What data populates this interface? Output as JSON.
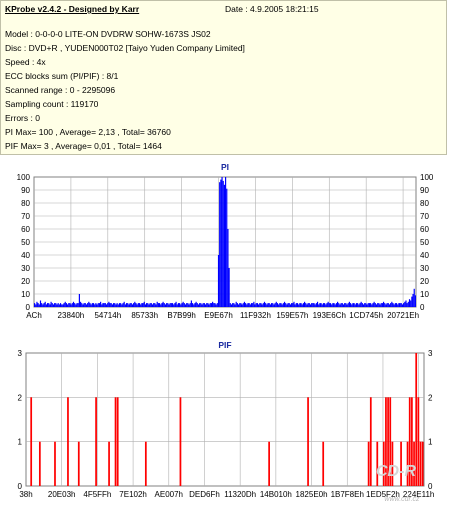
{
  "header": {
    "title": "KProbe v2.4.2 - Designed by Karr",
    "date": "Date : 4.9.2005 18:21:15"
  },
  "info_lines": [
    "Model : 0-0-0-0 LITE-ON DVDRW SOHW-1673S JS02",
    "Disc : DVD+R , YUDEN000T02 [Taiyo Yuden Company Limited]",
    "Speed : 4x",
    "ECC blocks sum (PI/PIF) : 8/1",
    "Scanned range : 0 - 2295096",
    "Sampling count : 119170",
    "Errors : 0",
    "PI Max= 100 , Average= 2,13 , Total= 36760",
    "PIF Max= 3 , Average= 0,01 , Total= 1464"
  ],
  "colors": {
    "info_bg": "#ffffe6",
    "pi_bar": "#0000ff",
    "pif_bar": "#ff0000",
    "title": "#1a2aa0",
    "grid": "#b0b0b0"
  },
  "watermark": "CD-R",
  "watermark_url": "www.cdr.cz",
  "chart_data": [
    {
      "type": "bar",
      "title": "PI",
      "xlabel": "",
      "ylabel": "",
      "ylim": [
        0,
        100
      ],
      "yticks": [
        0,
        10,
        20,
        30,
        40,
        50,
        60,
        70,
        80,
        90,
        100
      ],
      "grid": true,
      "x_tick_labels": [
        "ACh",
        "23840h",
        "54714h",
        "85733h",
        "B7B99h",
        "E9E67h",
        "11F932h",
        "159E57h",
        "193E6Ch",
        "1CD745h",
        "20721Eh"
      ],
      "series": [
        {
          "values": [
            3,
            2,
            4,
            3,
            2,
            5,
            3,
            2,
            3,
            4,
            2,
            3,
            3,
            2,
            4,
            3,
            2,
            3,
            3,
            2,
            3,
            2,
            3,
            2,
            2,
            3,
            4,
            3,
            2,
            3,
            3,
            2,
            3,
            4,
            3,
            2,
            3,
            3,
            10,
            4,
            3,
            2,
            3,
            3,
            2,
            3,
            4,
            3,
            2,
            3,
            3,
            2,
            3,
            2,
            3,
            3,
            4,
            2,
            3,
            3,
            3,
            2,
            3,
            4,
            3,
            3,
            2,
            3,
            3,
            2,
            3,
            2,
            3,
            3,
            2,
            3,
            4,
            2,
            3,
            3,
            2,
            3,
            3,
            2,
            3,
            4,
            3,
            2,
            3,
            3,
            2,
            3,
            3,
            4,
            2,
            3,
            3,
            2,
            3,
            3,
            2,
            3,
            3,
            2,
            4,
            3,
            3,
            2,
            3,
            4,
            3,
            2,
            3,
            3,
            2,
            3,
            3,
            3,
            2,
            3,
            4,
            2,
            3,
            3,
            2,
            3,
            4,
            3,
            2,
            3,
            3,
            2,
            3,
            5,
            3,
            2,
            3,
            4,
            3,
            2,
            3,
            3,
            2,
            3,
            3,
            2,
            3,
            3,
            2,
            3,
            3,
            4,
            3,
            3,
            2,
            3,
            40,
            96,
            98,
            100,
            97,
            94,
            100,
            91,
            60,
            30,
            3,
            2,
            3,
            3,
            2,
            4,
            3,
            2,
            3,
            3,
            2,
            3,
            4,
            3,
            2,
            3,
            3,
            2,
            3,
            3,
            4,
            2,
            3,
            3,
            2,
            3,
            3,
            2,
            3,
            4,
            3,
            2,
            3,
            3,
            2,
            3,
            3,
            2,
            3,
            4,
            3,
            2,
            3,
            3,
            2,
            3,
            4,
            3,
            2,
            3,
            3,
            2,
            3,
            3,
            4,
            2,
            3,
            3,
            2,
            3,
            3,
            2,
            3,
            4,
            3,
            2,
            3,
            3,
            2,
            3,
            3,
            3,
            2,
            3,
            4,
            2,
            3,
            3,
            2,
            3,
            3,
            2,
            3,
            4,
            3,
            3,
            2,
            3,
            3,
            2,
            3,
            4,
            3,
            2,
            3,
            3,
            2,
            3,
            3,
            2,
            3,
            4,
            3,
            2,
            3,
            3,
            2,
            3,
            3,
            2,
            3,
            4,
            3,
            2,
            3,
            3,
            2,
            3,
            3,
            3,
            2,
            3,
            4,
            3,
            2,
            3,
            3,
            2,
            3,
            3,
            4,
            3,
            2,
            3,
            3,
            2,
            3,
            4,
            3,
            2,
            3,
            3,
            2,
            3,
            3,
            3,
            2,
            3,
            4,
            5,
            3,
            4,
            6,
            5,
            8,
            10,
            14,
            9
          ]
        }
      ]
    },
    {
      "type": "bar",
      "title": "PIF",
      "xlabel": "",
      "ylabel": "",
      "ylim": [
        0,
        3
      ],
      "yticks": [
        0,
        1,
        2,
        3
      ],
      "grid": true,
      "x_tick_labels": [
        "38h",
        "20E03h",
        "4F5FFh",
        "7E102h",
        "AE007h",
        "DED6Fh",
        "11320Dh",
        "14B010h",
        "1825E0h",
        "1B7F8Eh",
        "1ED5F2h",
        "224E11h"
      ],
      "series": [
        {
          "values": [
            0,
            0,
            2,
            0,
            0,
            0,
            1,
            0,
            0,
            0,
            0,
            0,
            0,
            1,
            0,
            0,
            0,
            0,
            0,
            2,
            0,
            0,
            0,
            0,
            1,
            0,
            0,
            0,
            0,
            0,
            0,
            0,
            2,
            0,
            0,
            0,
            0,
            0,
            1,
            0,
            0,
            2,
            2,
            0,
            0,
            0,
            0,
            0,
            0,
            0,
            0,
            0,
            0,
            0,
            0,
            1,
            0,
            0,
            0,
            0,
            0,
            0,
            0,
            0,
            0,
            0,
            0,
            0,
            0,
            0,
            0,
            2,
            0,
            0,
            0,
            0,
            0,
            0,
            0,
            0,
            0,
            0,
            0,
            0,
            0,
            0,
            0,
            0,
            0,
            0,
            0,
            0,
            0,
            0,
            0,
            0,
            0,
            0,
            0,
            0,
            0,
            0,
            0,
            0,
            0,
            0,
            0,
            0,
            0,
            0,
            0,
            0,
            1,
            0,
            0,
            0,
            0,
            0,
            0,
            0,
            0,
            0,
            0,
            0,
            0,
            0,
            0,
            0,
            0,
            0,
            2,
            0,
            0,
            0,
            0,
            0,
            0,
            1,
            0,
            0,
            0,
            0,
            0,
            0,
            0,
            0,
            0,
            0,
            0,
            0,
            0,
            0,
            0,
            0,
            0,
            0,
            0,
            0,
            1,
            2,
            0,
            0,
            1,
            0,
            0,
            1,
            2,
            2,
            2,
            1,
            0,
            0,
            0,
            1,
            0,
            0,
            1,
            2,
            2,
            1,
            3,
            2,
            1,
            1
          ]
        }
      ]
    }
  ]
}
